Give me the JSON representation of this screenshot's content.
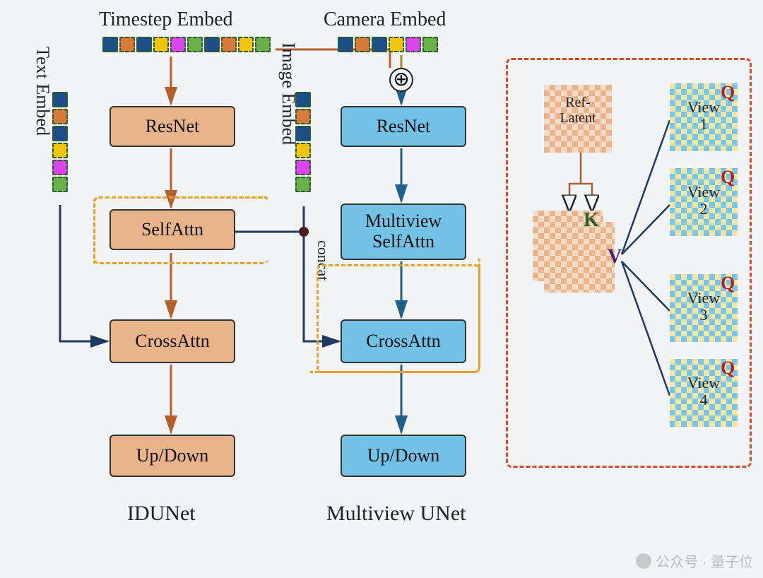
{
  "labels": {
    "timestep": "Timestep Embed",
    "camera": "Camera Embed",
    "text": "Text Embed",
    "image": "Image Embed",
    "concat": "concat"
  },
  "left": {
    "title": "IDUNet",
    "resnet": "ResNet",
    "selfattn": "SelfAttn",
    "crossattn": "CrossAttn",
    "updown": "Up/Down"
  },
  "right": {
    "title": "Multiview UNet",
    "resnet": "ResNet",
    "mv_selfattn_l1": "Multiview",
    "mv_selfattn_l2": "SelfAttn",
    "crossattn": "CrossAttn",
    "updown": "Up/Down"
  },
  "detail": {
    "ref_l1": "Ref-",
    "ref_l2": "Latent",
    "view1": "View 1",
    "view2": "View 2",
    "view3": "View 3",
    "view4": "View 4",
    "K": "K",
    "V": "V",
    "Q": "Q"
  },
  "embed_colors": [
    "c-blue",
    "c-orange",
    "c-blue",
    "c-yellow",
    "c-magenta",
    "c-green"
  ],
  "watermark": "公众号 · 量子位"
}
